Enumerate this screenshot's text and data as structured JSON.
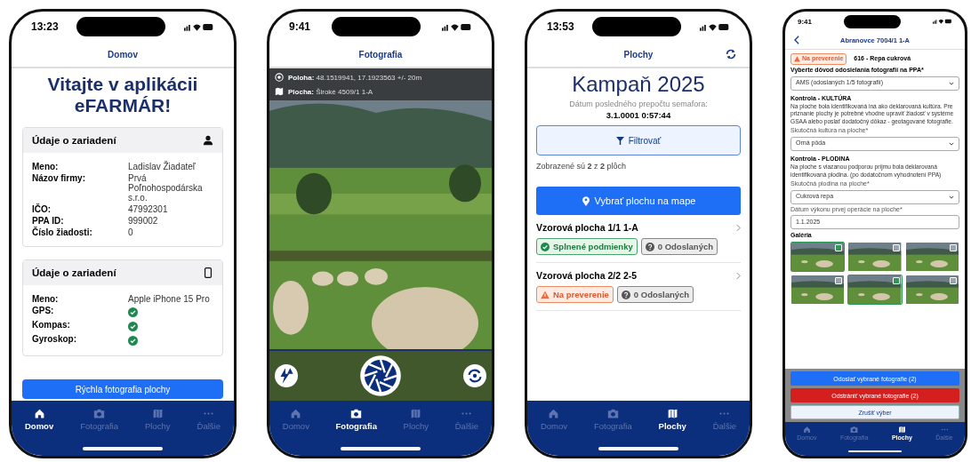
{
  "phones": [
    {
      "kind": "home",
      "time": "13:23",
      "title": "Domov",
      "heading": "Vitajte v aplikácii eFARMÁR!",
      "cards": [
        {
          "title": "Údaje o zariadení",
          "rows": [
            {
              "label": "Meno:",
              "value": "Ladislav Žiadateľ"
            },
            {
              "label": "Názov firmy:",
              "value": "Prvá Poľnohospodárska s.r.o."
            },
            {
              "label": "IČO:",
              "value": "47992301"
            },
            {
              "label": "PPA ID:",
              "value": "999002"
            },
            {
              "label": "Číslo žiadosti:",
              "value": "0"
            }
          ]
        },
        {
          "title": "Údaje o zariadení",
          "rows": [
            {
              "label": "Meno:",
              "value": "Apple iPhone 15 Pro"
            },
            {
              "label": "GPS:",
              "checked": true
            },
            {
              "label": "Kompas:",
              "checked": true
            },
            {
              "label": "Gyroskop:",
              "checked": true
            }
          ]
        }
      ],
      "button": "Rýchla fotografia plochy",
      "tabs": [
        {
          "label": "Domov",
          "selected": true
        },
        {
          "label": "Fotografia",
          "selected": false
        },
        {
          "label": "Plochy",
          "selected": false
        },
        {
          "label": "Ďalšie",
          "selected": false
        }
      ]
    },
    {
      "kind": "camera",
      "time": "9:41",
      "title": "Fotografia",
      "info": [
        {
          "label": "Poloha:",
          "value": "48.1519941, 17.1923563 +/- 20m"
        },
        {
          "label": "Plocha:",
          "value": "Široké 4509/1 1-A"
        }
      ],
      "tabs": [
        {
          "label": "Domov",
          "selected": false
        },
        {
          "label": "Fotografia",
          "selected": true
        },
        {
          "label": "Plochy",
          "selected": false
        },
        {
          "label": "Ďalšie",
          "selected": false
        }
      ]
    },
    {
      "kind": "fields",
      "time": "13:53",
      "title": "Plochy",
      "heading": "Kampaň 2025",
      "date_label": "Dátum posledného prepočtu semafora:",
      "date": "3.1.0001 0:57:44",
      "filter": "Filtrovať",
      "count": "Zobrazené sú **2** z **2** plôch",
      "map_button": "Vybrať plochu na mape",
      "items": [
        {
          "name": "Vzorová plocha 1/1 1-A",
          "badges": [
            {
              "kind": "ok",
              "label": "Splnené podmienky"
            },
            {
              "kind": "unknown",
              "label": "0 Odoslaných"
            }
          ]
        },
        {
          "name": "Vzorová plocha 2/2 2-5",
          "badges": [
            {
              "kind": "warn",
              "label": "Na preverenie"
            },
            {
              "kind": "unknown",
              "label": "0 Odoslaných"
            }
          ]
        }
      ],
      "tabs": [
        {
          "label": "Domov",
          "selected": false
        },
        {
          "label": "Fotografia",
          "selected": false
        },
        {
          "label": "Plochy",
          "selected": true
        },
        {
          "label": "Ďalšie",
          "selected": false
        }
      ]
    },
    {
      "kind": "detail",
      "time": "9:41",
      "title": "Abranovce 7004/1 1-A",
      "badge": {
        "kind": "warn",
        "label": "Na preverenie"
      },
      "crop": "616 - Repa cukrová",
      "reason_label": "Vyberte dôvod odosielania fotografií na PPA*",
      "reason": "AMS (odoslaných 1/5 fotografií)",
      "sections": [
        {
          "title": "Kontrola - KULTÚRA",
          "text": "Na ploche bola identifikovaná iná ako deklarovaná kultúra. Pre priznanie plochy je potrebné vhodne upraviť žiadosť v systéme GSAA alebo poslať dodatočný dôkaz - geotagované fotografie.",
          "field_label": "Skutočná kultúra na ploche*",
          "value": "Orná pôda"
        },
        {
          "title": "Kontrola - PLODINA",
          "text": "Na ploche s viazanou podporou príjmu bola deklarovaná identifikovaná plodina. (po dodatočnom vyhodnotení PPA)",
          "field_label": "Skutočná plodina na ploche*",
          "value": "Cukrová repa"
        }
      ],
      "date_label": "Dátum výkonu prvej operácie na ploche*",
      "date": "1.1.2025",
      "gallery_title": "Galéria",
      "photos": [
        {
          "selected": true
        },
        {
          "selected": false
        },
        {
          "selected": false
        },
        {
          "selected": false
        },
        {
          "selected": true
        },
        {
          "selected": false
        }
      ],
      "actions": [
        {
          "kind": "primary",
          "label": "Odoslať vybrané fotografie (2)"
        },
        {
          "kind": "danger",
          "label": "Odstrániť vybrané fotografie (2)"
        },
        {
          "kind": "plain",
          "label": "Zrušiť výber"
        }
      ],
      "tabs": [
        {
          "label": "Domov",
          "selected": false
        },
        {
          "label": "Fotografia",
          "selected": false
        },
        {
          "label": "Plochy",
          "selected": true
        },
        {
          "label": "Ďalšie",
          "selected": false
        }
      ]
    }
  ]
}
